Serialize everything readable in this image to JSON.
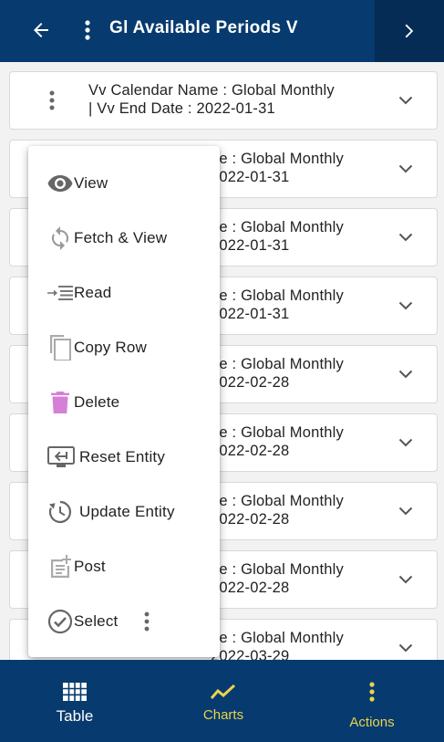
{
  "app_bar": {
    "title": "Gl Available Periods V",
    "back_icon": "arrow-left-icon",
    "menu_icon": "more-vert-icon",
    "next_icon": "chevron-right-icon"
  },
  "records": [
    {
      "line1": "Vv Calendar Name  : Global Monthly",
      "line2": "| Vv End Date  : 2022-01-31"
    },
    {
      "line1": "ne  : Global Monthly",
      "line2": "2022-01-31"
    },
    {
      "line1": "ne  : Global Monthly",
      "line2": "2022-01-31"
    },
    {
      "line1": "ne  : Global Monthly",
      "line2": "2022-01-31"
    },
    {
      "line1": "ne  : Global Monthly",
      "line2": "2022-02-28"
    },
    {
      "line1": "ne  : Global Monthly",
      "line2": "2022-02-28"
    },
    {
      "line1": "ne  : Global Monthly",
      "line2": "2022-02-28"
    },
    {
      "line1": "ne  : Global Monthly",
      "line2": "2022-02-28"
    },
    {
      "line1": "ne  : Global Monthly",
      "line2": "2022-03-29"
    }
  ],
  "context_menu": {
    "items": [
      {
        "label": "View",
        "icon": "eye-icon"
      },
      {
        "label": "Fetch & View",
        "icon": "refresh-icon"
      },
      {
        "label": "Read",
        "icon": "read-indent-icon"
      },
      {
        "label": "Copy Row",
        "icon": "copy-icon"
      },
      {
        "label": "Delete",
        "icon": "trash-icon"
      },
      {
        "label": "Reset Entity",
        "icon": "reset-entity-icon"
      },
      {
        "label": "Update Entity",
        "icon": "update-history-icon"
      },
      {
        "label": "Post",
        "icon": "post-add-icon"
      },
      {
        "label": "Select",
        "icon": "check-circle-icon"
      }
    ]
  },
  "bottom_nav": {
    "tabs": [
      {
        "label": "Table",
        "icon": "table-grid-icon"
      },
      {
        "label": "Charts",
        "icon": "line-chart-icon"
      },
      {
        "label": "Actions",
        "icon": "more-vert-icon"
      }
    ]
  },
  "colors": {
    "primary": "#073a6e",
    "accent": "#e8d44d",
    "delete_icon": "#d77fd6",
    "icon_gray": "#8a8a8a"
  }
}
